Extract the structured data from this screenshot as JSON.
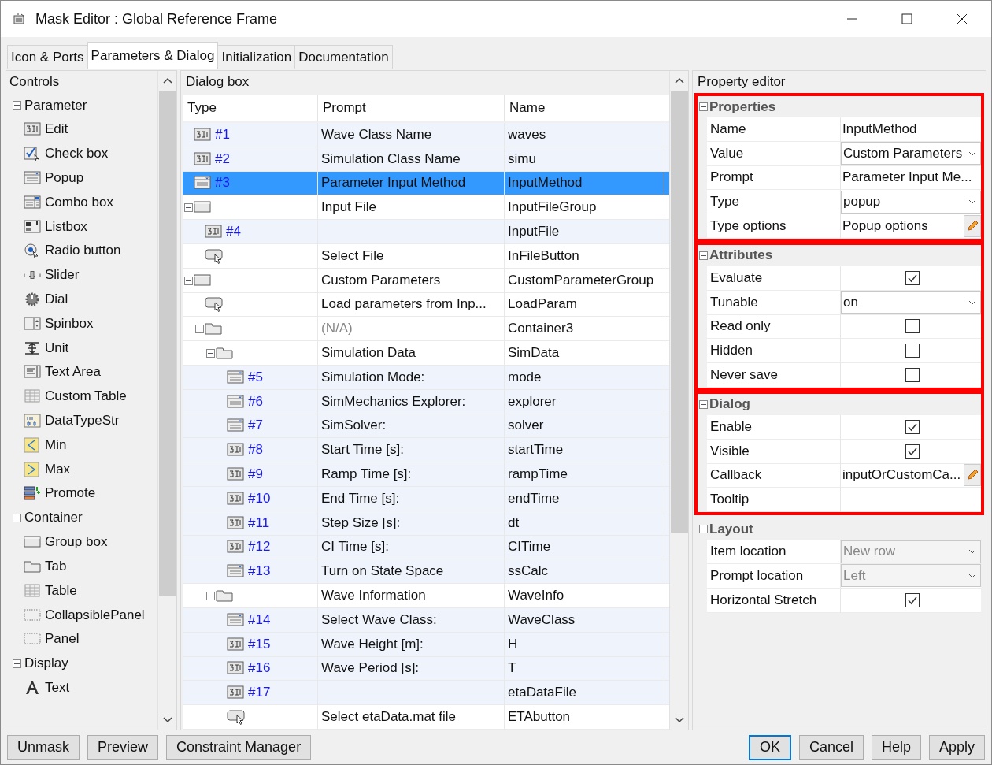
{
  "window": {
    "title": "Mask Editor : Global Reference Frame"
  },
  "tabs": [
    {
      "label": "Icon & Ports",
      "selected": false
    },
    {
      "label": "Parameters & Dialog",
      "selected": true
    },
    {
      "label": "Initialization",
      "selected": false
    },
    {
      "label": "Documentation",
      "selected": false
    }
  ],
  "controls": {
    "title": "Controls",
    "sections": [
      {
        "title": "Parameter",
        "expanded": true,
        "items": [
          "Edit",
          "Check box",
          "Popup",
          "Combo box",
          "Listbox",
          "Radio button",
          "Slider",
          "Dial",
          "Spinbox",
          "Unit",
          "Text Area",
          "Custom Table",
          "DataTypeStr",
          "Min",
          "Max",
          "Promote"
        ]
      },
      {
        "title": "Container",
        "expanded": true,
        "items": [
          "Group box",
          "Tab",
          "Table",
          "CollapsiblePanel",
          "Panel"
        ]
      },
      {
        "title": "Display",
        "expanded": true,
        "items": [
          "Text"
        ]
      }
    ]
  },
  "dialog_box": {
    "title": "Dialog box",
    "columns": [
      "Type",
      "Prompt",
      "Name"
    ],
    "rows": [
      {
        "kind": "edit",
        "number": "#1",
        "prompt": "Wave Class Name",
        "name": "waves",
        "selected": false
      },
      {
        "kind": "edit",
        "number": "#2",
        "prompt": "Simulation Class Name",
        "name": "simu",
        "selected": false
      },
      {
        "kind": "popup",
        "number": "#3",
        "prompt": "Parameter Input Method",
        "name": "InputMethod",
        "selected": true
      },
      {
        "kind": "group",
        "prompt": "Input File",
        "name": "InputFileGroup",
        "selected": false,
        "expanded": true,
        "children": [
          {
            "kind": "edit",
            "number": "#4",
            "name": "InputFile",
            "selected": false
          },
          {
            "kind": "button",
            "prompt": "Select File",
            "name": "InFileButton",
            "selected": false
          }
        ]
      },
      {
        "kind": "group",
        "prompt": "Custom Parameters",
        "name": "CustomParameterGroup",
        "selected": false,
        "expanded": true,
        "children": [
          {
            "kind": "button",
            "prompt": "Load parameters from Inp...",
            "name": "LoadParam",
            "selected": false
          },
          {
            "kind": "tab",
            "prompt": "(N/A)",
            "name": "Container3",
            "selected": false,
            "expanded": true,
            "dimmed": true,
            "children": [
              {
                "kind": "tab",
                "prompt": "Simulation Data",
                "name": "SimData",
                "selected": false,
                "expanded": true,
                "children": [
                  {
                    "kind": "popup",
                    "number": "#5",
                    "prompt": "Simulation Mode:",
                    "name": "mode",
                    "selected": false
                  },
                  {
                    "kind": "popup",
                    "number": "#6",
                    "prompt": "SimMechanics Explorer:",
                    "name": "explorer",
                    "selected": false
                  },
                  {
                    "kind": "popup",
                    "number": "#7",
                    "prompt": "SimSolver:",
                    "name": "solver",
                    "selected": false
                  },
                  {
                    "kind": "edit",
                    "number": "#8",
                    "prompt": "Start Time [s]:",
                    "name": "startTime",
                    "selected": false
                  },
                  {
                    "kind": "edit",
                    "number": "#9",
                    "prompt": "Ramp Time [s]:",
                    "name": "rampTime",
                    "selected": false
                  },
                  {
                    "kind": "edit",
                    "number": "#10",
                    "prompt": "End Time [s]:",
                    "name": "endTime",
                    "selected": false
                  },
                  {
                    "kind": "edit",
                    "number": "#11",
                    "prompt": "Step Size [s]:",
                    "name": "dt",
                    "selected": false
                  },
                  {
                    "kind": "edit",
                    "number": "#12",
                    "prompt": "CI Time [s]:",
                    "name": "CITime",
                    "selected": false
                  },
                  {
                    "kind": "popup",
                    "number": "#13",
                    "prompt": "Turn on State Space",
                    "name": "ssCalc",
                    "selected": false
                  }
                ]
              },
              {
                "kind": "tab",
                "prompt": "Wave Information",
                "name": "WaveInfo",
                "selected": false,
                "expanded": true,
                "children": [
                  {
                    "kind": "popup",
                    "number": "#14",
                    "prompt": "Select Wave Class:",
                    "name": "WaveClass",
                    "selected": false
                  },
                  {
                    "kind": "edit",
                    "number": "#15",
                    "prompt": "Wave Height [m]:",
                    "name": "H",
                    "selected": false
                  },
                  {
                    "kind": "edit",
                    "number": "#16",
                    "prompt": "Wave Period [s]:",
                    "name": "T",
                    "selected": false
                  },
                  {
                    "kind": "edit",
                    "number": "#17",
                    "name": "etaDataFile",
                    "selected": false
                  },
                  {
                    "kind": "button",
                    "prompt": "Select etaData.mat file",
                    "name": "ETAbutton",
                    "selected": false
                  }
                ]
              }
            ]
          }
        ]
      }
    ]
  },
  "property_editor": {
    "title": "Property editor",
    "sections": [
      {
        "title": "Properties",
        "expanded": true,
        "highlighted": true,
        "rows": [
          {
            "kind": "text",
            "label": "Name",
            "value": "InputMethod"
          },
          {
            "kind": "dropdown",
            "label": "Value",
            "value": "Custom Parameters",
            "disabled": false
          },
          {
            "kind": "text",
            "label": "Prompt",
            "value": "Parameter Input Me..."
          },
          {
            "kind": "dropdown",
            "label": "Type",
            "value": "popup",
            "disabled": false
          },
          {
            "kind": "editable",
            "label": "Type options",
            "value": "Popup options"
          }
        ]
      },
      {
        "title": "Attributes",
        "expanded": true,
        "highlighted": true,
        "rows": [
          {
            "kind": "checkbox",
            "label": "Evaluate",
            "checked": true
          },
          {
            "kind": "dropdown",
            "label": "Tunable",
            "value": "on",
            "disabled": false
          },
          {
            "kind": "checkbox",
            "label": "Read only",
            "checked": false
          },
          {
            "kind": "checkbox",
            "label": "Hidden",
            "checked": false
          },
          {
            "kind": "checkbox",
            "label": "Never save",
            "checked": false
          }
        ]
      },
      {
        "title": "Dialog",
        "expanded": true,
        "highlighted": true,
        "rows": [
          {
            "kind": "checkbox",
            "label": "Enable",
            "checked": true
          },
          {
            "kind": "checkbox",
            "label": "Visible",
            "checked": true
          },
          {
            "kind": "editable",
            "label": "Callback",
            "value": "inputOrCustomCa..."
          },
          {
            "kind": "empty",
            "label": "Tooltip"
          }
        ]
      },
      {
        "title": "Layout",
        "expanded": true,
        "highlighted": false,
        "rows": [
          {
            "kind": "dropdown",
            "label": "Item location",
            "value": "New row",
            "disabled": true
          },
          {
            "kind": "dropdown",
            "label": "Prompt location",
            "value": "Left",
            "disabled": true
          },
          {
            "kind": "checkbox",
            "label": "Horizontal Stretch",
            "checked": true
          }
        ]
      }
    ]
  },
  "footer": {
    "left_buttons": [
      "Unmask",
      "Preview",
      "Constraint Manager"
    ],
    "right_buttons": [
      {
        "label": "OK",
        "default": true
      },
      {
        "label": "Cancel",
        "default": false
      },
      {
        "label": "Help",
        "default": false
      },
      {
        "label": "Apply",
        "default": false
      }
    ]
  }
}
